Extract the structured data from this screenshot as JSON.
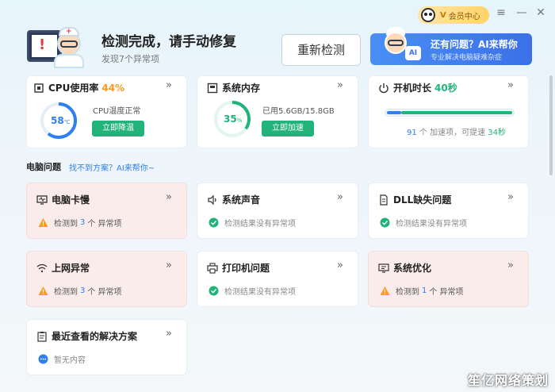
{
  "window": {
    "member_label": "会员中心",
    "menu_icon": "≡",
    "minimize_icon": "—",
    "close_icon": "✕"
  },
  "header": {
    "title": "检测完成，请手动修复",
    "subtitle": "发现7个异常项",
    "recheck_label": "重新检测",
    "ai_banner": {
      "title": "还有问题？AI来帮你",
      "subtitle": "专业解决电脑疑难杂症",
      "badge": "AI"
    }
  },
  "top_cards": {
    "cpu": {
      "title": "CPU使用率",
      "value": "44%",
      "temp_value": "58",
      "temp_unit": "℃",
      "status": "CPU温度正常",
      "button": "立即降温"
    },
    "memory": {
      "title": "系统内存",
      "percent": "35",
      "percent_unit": "%",
      "used": "已用5.6GB/15.8GB",
      "button": "立即加速"
    },
    "boot": {
      "title": "开机时长",
      "value": "40秒",
      "items_count": "91",
      "items_text": "个 加速项，可提速",
      "speedup": "34秒"
    }
  },
  "section": {
    "title": "电脑问题",
    "link": "找不到方案？AI来帮你~"
  },
  "issues": [
    {
      "title": "电脑卡慢",
      "prefix": "检测到",
      "count": "3",
      "suffix": "个 异常项",
      "state": "warn"
    },
    {
      "title": "系统声音",
      "text": "检测结果没有异常项",
      "state": "ok"
    },
    {
      "title": "DLL缺失问题",
      "text": "检测结果没有异常项",
      "state": "ok"
    },
    {
      "title": "上网异常",
      "prefix": "检测到",
      "count": "3",
      "suffix": "个 异常项",
      "state": "warn"
    },
    {
      "title": "打印机问题",
      "text": "检测结果没有异常项",
      "state": "ok"
    },
    {
      "title": "系统优化",
      "prefix": "检测到",
      "count": "1",
      "suffix": "个 异常项",
      "state": "warn"
    },
    {
      "title": "最近查看的解决方案",
      "text": "暂无内容",
      "state": "info"
    }
  ],
  "chevron": "»",
  "watermark": "笙亿网络策划",
  "colors": {
    "accent": "#2f7fec",
    "green": "#22b37a",
    "orange": "#ff9a1f",
    "warn_bg": "#fbecec"
  }
}
